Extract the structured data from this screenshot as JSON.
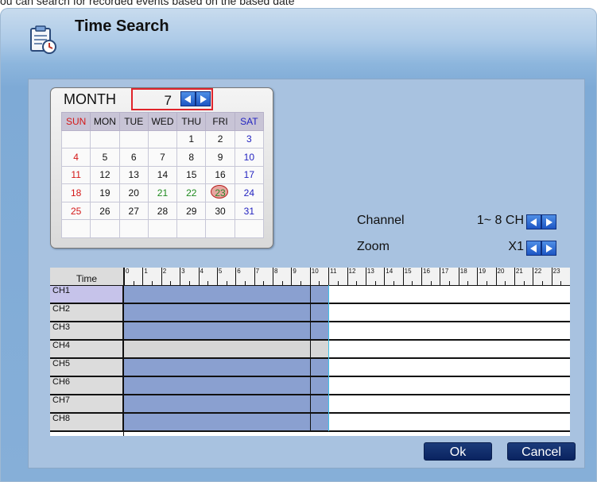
{
  "top_cut_text": "ou can search for recorded events based on the based date",
  "window": {
    "title": "Time Search"
  },
  "calendar": {
    "month_label": "MONTH",
    "month_value": "7",
    "weekdays": [
      "SUN",
      "MON",
      "TUE",
      "WED",
      "THU",
      "FRI",
      "SAT"
    ],
    "weeks": [
      [
        "",
        "",
        "",
        "",
        "1",
        "2",
        "3"
      ],
      [
        "4",
        "5",
        "6",
        "7",
        "8",
        "9",
        "10"
      ],
      [
        "11",
        "12",
        "13",
        "14",
        "15",
        "16",
        "17"
      ],
      [
        "18",
        "19",
        "20",
        "21",
        "22",
        "23",
        "24"
      ],
      [
        "25",
        "26",
        "27",
        "28",
        "29",
        "30",
        "31"
      ],
      [
        "",
        "",
        "",
        "",
        "",
        "",
        ""
      ]
    ],
    "selected_day": "23",
    "recorded_days": [
      "21",
      "22"
    ]
  },
  "channel": {
    "label": "Channel",
    "value": "1~ 8 CH"
  },
  "zoom": {
    "label": "Zoom",
    "value": "X1"
  },
  "timeline": {
    "time_label": "Time",
    "hours": [
      "0",
      "1",
      "2",
      "3",
      "4",
      "5",
      "6",
      "7",
      "8",
      "9",
      "10",
      "11",
      "12",
      "13",
      "14",
      "15",
      "16",
      "17",
      "18",
      "19",
      "20",
      "21",
      "22",
      "23"
    ],
    "channels": [
      "CH1",
      "CH2",
      "CH3",
      "CH4",
      "CH5",
      "CH6",
      "CH7",
      "CH8"
    ],
    "selected_channel": "CH1",
    "recording_end_hour": 11,
    "no_recording_channels": [
      "CH4"
    ],
    "cursor_hour": 11
  },
  "buttons": {
    "ok": "Ok",
    "cancel": "Cancel"
  },
  "colors": {
    "recorded": "#8aa0d0",
    "selection": "#e0242b",
    "accent": "#1d56c4"
  }
}
